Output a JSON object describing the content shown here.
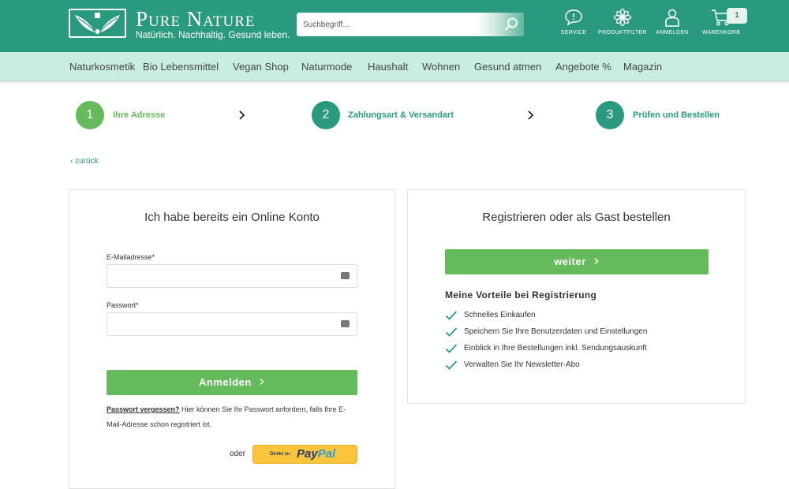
{
  "header": {
    "brand": "Pure Nature",
    "tagline": "Natürlich. Nachhaltig. Gesund leben.",
    "search_placeholder": "Suchbegriff...",
    "icons": [
      {
        "name": "service",
        "label": "SERVICE",
        "icon": "speech-bubble-icon"
      },
      {
        "name": "produktfilter",
        "label": "PRODUKTFILTER",
        "icon": "flower-icon"
      },
      {
        "name": "anmelden",
        "label": "ANMELDEN",
        "icon": "user-icon"
      },
      {
        "name": "warenkorb",
        "label": "WARENKORB",
        "icon": "cart-icon"
      }
    ],
    "cart_count": "1",
    "colors": {
      "primary": "#2a9a7e",
      "nav_bg": "#c9eee0",
      "green": "#65bb5b"
    }
  },
  "nav": {
    "items": [
      "Naturkosmetik",
      "Bio Lebensmittel",
      "Vegan Shop",
      "Naturmode",
      "Haushalt",
      "Wohnen",
      "Gesund atmen",
      "Angebote %",
      "Magazin"
    ]
  },
  "steps": [
    {
      "number": "1",
      "label": "Ihre Adresse",
      "color": "#65bb5b"
    },
    {
      "number": "2",
      "label": "Zahlungsart & Versandart",
      "color": "#2a9a7e"
    },
    {
      "number": "3",
      "label": "Prüfen und Bestellen",
      "color": "#2a9a7e"
    }
  ],
  "back_label": "zurück",
  "login": {
    "title": "Ich habe bereits ein Online Konto",
    "email_label": "E-Mailadresse*",
    "email_value": "",
    "password_label": "Passwort*",
    "password_value": "",
    "submit_label": "Anmelden",
    "forgot_link": "Passwort vergessen?",
    "forgot_text_1": " Hier können Sie Ihr Passwort anfordern, falls Ihre E-",
    "forgot_text_2": "Mail-Adresse schon registriert ist.",
    "or_label": "oder",
    "paypal_prefix": "Direkt zu",
    "paypal_pay": "Pay",
    "paypal_pal": "Pal"
  },
  "register": {
    "title": "Registrieren oder als Gast bestellen",
    "continue_label": "weiter",
    "benefits_title": "Meine Vorteile bei Registrierung",
    "benefits": [
      "Schnelles Einkaufen",
      "Speichern Sie Ihre Benutzerdaten und Einstellungen",
      "Einblick in Ihre Bestellungen inkl. Sendungsauskunft",
      "Verwalten Sie Ihr Newsletter-Abo"
    ]
  }
}
